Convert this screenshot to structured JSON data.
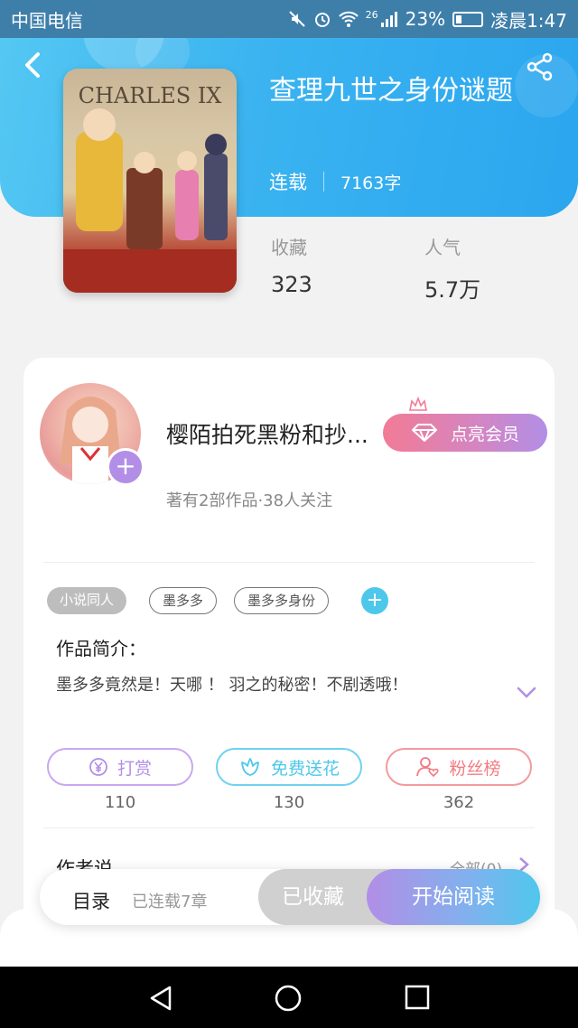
{
  "status_bar": {
    "carrier": "中国电信",
    "network": "26",
    "battery": "23%",
    "time": "凌晨1:47"
  },
  "book": {
    "title": "查理九世之身份谜题",
    "status": "连载",
    "word_count": "7163字",
    "cover_text": "CHARLES IX",
    "stats": [
      {
        "label": "收藏",
        "value": "323"
      },
      {
        "label": "人气",
        "value": "5.7万"
      }
    ]
  },
  "author": {
    "name": "樱陌拍死黑粉和抄...",
    "info": "著有2部作品·38人关注",
    "vip_button": "点亮会员",
    "follow_plus": "+"
  },
  "tags": [
    "小说同人",
    "墨多多",
    "墨多多身份"
  ],
  "tag_add": "+",
  "intro": {
    "heading": "作品简介：",
    "text": "墨多多竟然是！天哪 ！ 羽之的秘密！不剧透哦！"
  },
  "actions": [
    {
      "label": "打赏",
      "count": "110",
      "icon": "yen-icon",
      "color": "#b28ee6"
    },
    {
      "label": "免费送花",
      "count": "130",
      "icon": "flower-icon",
      "color": "#4ec8ea"
    },
    {
      "label": "粉丝榜",
      "count": "362",
      "icon": "fan-rank-icon",
      "color": "#f27b82"
    }
  ],
  "author_say": {
    "heading": "作者说",
    "all_link": "全部(0)"
  },
  "bottom": {
    "toc_label": "目录",
    "toc_info": "已连载7章",
    "collected_label": "已收藏",
    "read_label": "开始阅读"
  },
  "colors": {
    "header_blue": "#3ab3f0",
    "accent_purple": "#b28ee6",
    "accent_pink": "#f27b95",
    "accent_cyan": "#4ec8ea"
  }
}
